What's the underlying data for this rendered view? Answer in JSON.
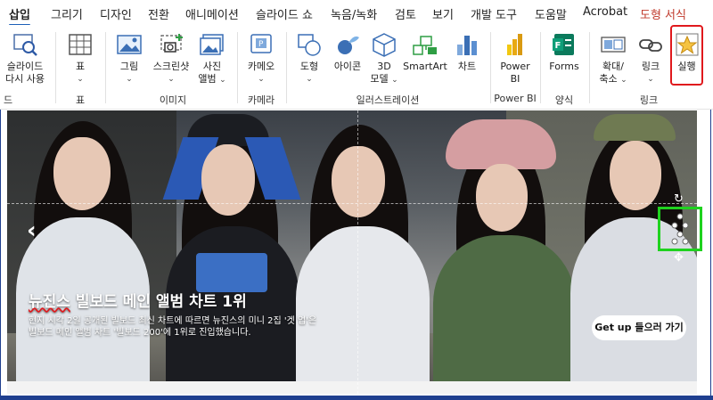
{
  "tabs": [
    {
      "label": "삽입",
      "state": "active"
    },
    {
      "label": "그리기"
    },
    {
      "label": "디자인"
    },
    {
      "label": "전환"
    },
    {
      "label": "애니메이션"
    },
    {
      "label": "슬라이드 쇼"
    },
    {
      "label": "녹음/녹화"
    },
    {
      "label": "검토"
    },
    {
      "label": "보기"
    },
    {
      "label": "개발 도구"
    },
    {
      "label": "도움말"
    },
    {
      "label": "Acrobat"
    },
    {
      "label": "도형 서식",
      "state": "shape"
    }
  ],
  "ribbon": {
    "reuse": {
      "line1": "슬라이드",
      "line2": "다시 사용",
      "group": "드"
    },
    "table": {
      "label": "표",
      "group": "표"
    },
    "picture": {
      "label": "그림"
    },
    "screenshot": {
      "label": "스크린샷"
    },
    "album": {
      "label": "사진",
      "label2": "앨범"
    },
    "images_group": "이미지",
    "camera": {
      "label": "카메오",
      "group": "카메라"
    },
    "shapes": {
      "label": "도형"
    },
    "icons": {
      "label": "아이콘"
    },
    "model3d": {
      "label": "3D",
      "label2": "모델"
    },
    "smartart": {
      "label": "SmartArt"
    },
    "chart": {
      "label": "차트"
    },
    "illustrations_group": "일러스트레이션",
    "powerbi": {
      "label": "Power",
      "label2": "BI",
      "group": "Power BI"
    },
    "forms": {
      "label": "Forms",
      "group": "양식"
    },
    "zoom": {
      "label": "확대/",
      "label2": "축소"
    },
    "link": {
      "label": "링크"
    },
    "action": {
      "label": "실행"
    },
    "links_group": "링크"
  },
  "slide": {
    "headline_a": "뉴진스",
    "headline_b": " 빌보드 메인 앨범 차트 1위",
    "sub1": "현지 시각 2일 공개된 빌보드 최신 차트에 따르면 뉴진스의 미니 2집 '겟 업'은",
    "sub2": "빌보드 메인 앨범 차트 '빌보드 200'에 1위로 진입했습니다.",
    "cta": "Get up 들으러 가기",
    "prev_arrow": "‹"
  },
  "colors": {
    "accent": "#1d5fb8",
    "highlight": "#e0191d",
    "selection": "#1fd21f"
  }
}
